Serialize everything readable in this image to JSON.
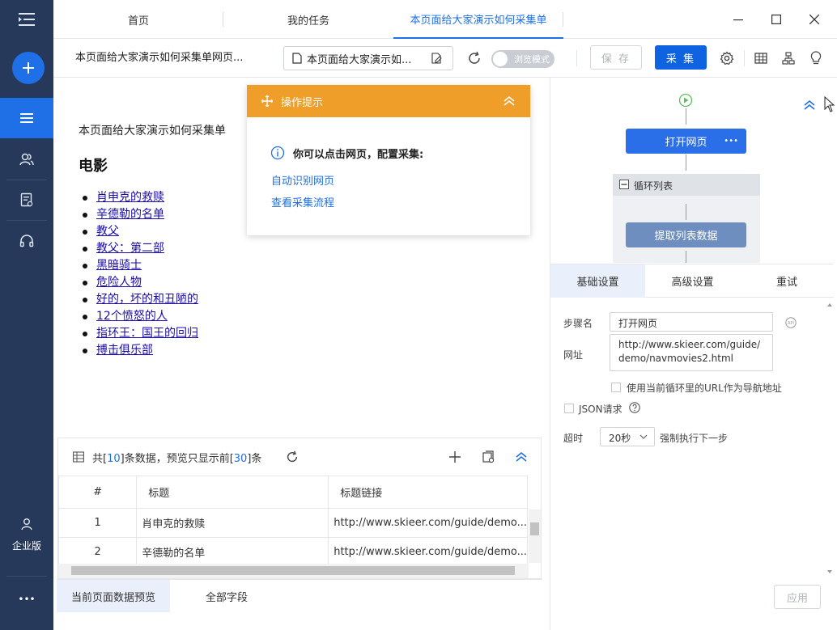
{
  "colors": {
    "sidebar": "#27395a",
    "accent": "#1f6fe6",
    "tips_orange": "#f09e2a",
    "node_blue": "#2a6ee8",
    "node_muted": "#6e8ebf"
  },
  "sidebar": {
    "menu_icon": "menu-icon",
    "add_icon": "plus-icon",
    "items": [
      {
        "icon": "list-icon",
        "active": true
      },
      {
        "icon": "users-icon",
        "active": false
      },
      {
        "icon": "task-icon",
        "active": false
      },
      {
        "icon": "headset-icon",
        "active": false
      }
    ],
    "enterprise_label": "企业版",
    "more_label": "•••"
  },
  "tabs": [
    {
      "label": "首页",
      "active": false
    },
    {
      "label": "我的任务",
      "active": false
    },
    {
      "label": "本页面给大家演示如何采集单",
      "active": true
    }
  ],
  "toolbar": {
    "task_title": "本页面给大家演示如何采集单网页...",
    "url_field": "本页面给大家演示如...",
    "browse_mode_label": "浏览模式",
    "save_label": "保 存",
    "collect_label": "采 集"
  },
  "webpage": {
    "intro": "本页面给大家演示如何采集单",
    "heading": "电影",
    "movies": [
      "肖申克的救赎",
      "辛德勒的名单",
      "教父",
      "教父：第二部",
      "黑暗骑士",
      "危险人物",
      "好的，坏的和丑陋的",
      "12个愤怒的人",
      "指环王：国王的回归",
      "搏击俱乐部"
    ]
  },
  "tips": {
    "title": "操作提示",
    "message": "你可以点击网页，配置采集:",
    "link_auto": "自动识别网页",
    "link_flow": "查看采集流程"
  },
  "preview": {
    "count_prefix": "共[",
    "count": "10",
    "count_mid": "]条数据，预览只显示前[",
    "shown": "30",
    "count_suffix": "]条",
    "columns": [
      "#",
      "标题",
      "标题链接"
    ],
    "rows": [
      {
        "n": "1",
        "title": "肖申克的救赎",
        "link": "http://www.skieer.com/guide/demo..."
      },
      {
        "n": "2",
        "title": "辛德勒的名单",
        "link": "http://www.skieer.com/guide/demo..."
      }
    ]
  },
  "bottom_tabs": [
    "当前页面数据预览",
    "全部字段"
  ],
  "flow": {
    "open_page": "打开网页",
    "node_more": "•••",
    "loop_list": "循环列表",
    "extract": "提取列表数据"
  },
  "settings": {
    "tabs": [
      "基础设置",
      "高级设置",
      "重试"
    ],
    "step_name_label": "步骤名",
    "step_name_value": "打开网页",
    "url_label": "网址",
    "url_value": "http://www.skieer.com/guide/demo/navmovies2.html",
    "use_loop_url_label": "使用当前循环里的URL作为导航地址",
    "json_label": "JSON请求",
    "timeout_label": "超时",
    "timeout_value": "20秒",
    "timeout_suffix": "强制执行下一步",
    "apply_label": "应用"
  }
}
